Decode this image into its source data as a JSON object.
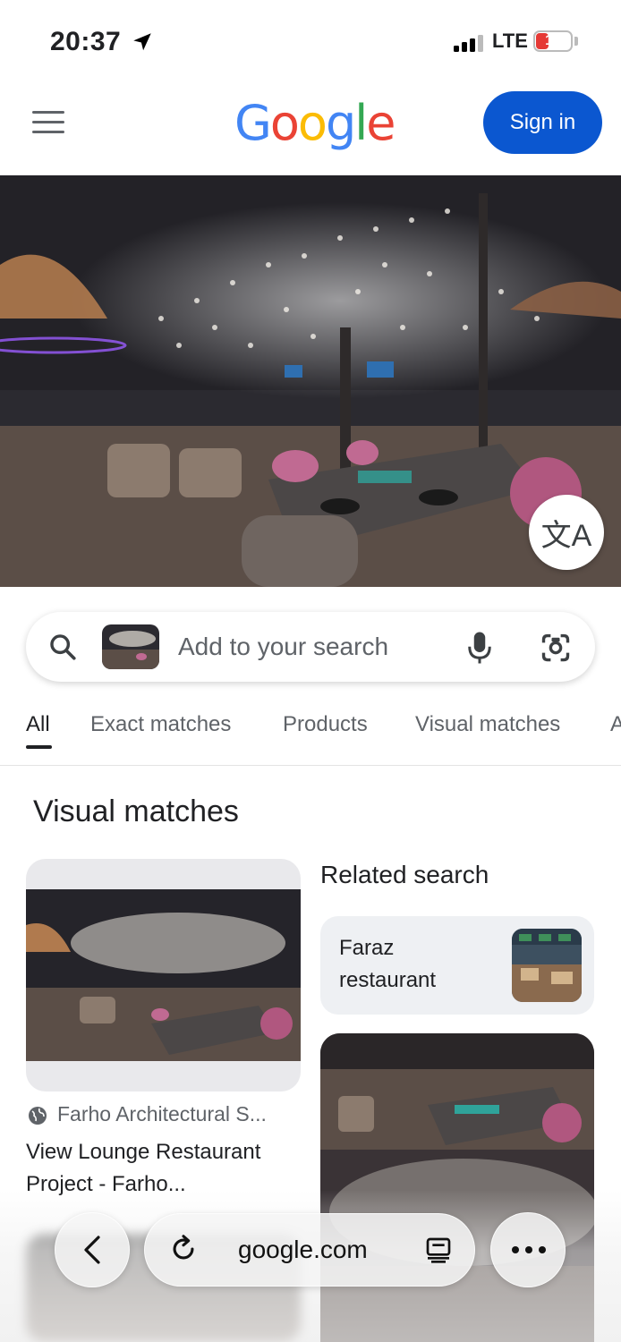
{
  "status_bar": {
    "time": "20:37",
    "network": "LTE",
    "battery": "14",
    "battery_level": 0.14
  },
  "header": {
    "logo_letters": [
      {
        "char": "G",
        "color": "#4285F4"
      },
      {
        "char": "o",
        "color": "#EA4335"
      },
      {
        "char": "o",
        "color": "#FBBC05"
      },
      {
        "char": "g",
        "color": "#4285F4"
      },
      {
        "char": "l",
        "color": "#34A853"
      },
      {
        "char": "e",
        "color": "#EA4335"
      }
    ],
    "sign_in_label": "Sign in",
    "menu_icon": "hamburger-menu-icon"
  },
  "hero": {
    "translate_icon": "translate-icon"
  },
  "search": {
    "placeholder": "Add to your search",
    "search_icon": "search-icon",
    "mic_icon": "microphone-icon",
    "lens_icon": "google-lens-icon"
  },
  "tabs": [
    {
      "label": "All",
      "active": true
    },
    {
      "label": "Exact matches",
      "active": false
    },
    {
      "label": "Products",
      "active": false
    },
    {
      "label": "Visual matches",
      "active": false
    },
    {
      "label": "A",
      "active": false
    }
  ],
  "main": {
    "section_title": "Visual matches",
    "results": [
      {
        "source": "Farho Architectural S...",
        "title": "View Lounge Restaurant Project - Farho..."
      }
    ],
    "related": {
      "heading": "Related search",
      "chip_label": "Faraz restaurant"
    }
  },
  "browser": {
    "url": "google.com",
    "back_icon": "back-chevron-icon",
    "reload_icon": "reload-icon",
    "reader_icon": "reader-mode-icon",
    "more_icon": "more-ellipsis-icon"
  },
  "colors": {
    "accent": "#0b57d0",
    "battery_low": "#e53935"
  }
}
